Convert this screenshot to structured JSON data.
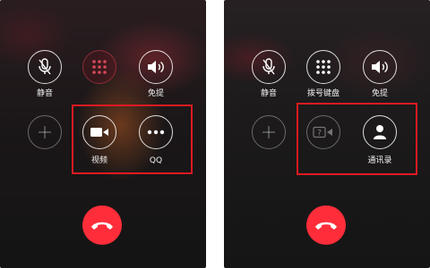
{
  "left_screen": {
    "mute_label": "静音",
    "speaker_label": "免提",
    "video_label": "视频",
    "qq_label": "QQ",
    "add_icon": "plus-icon",
    "keypad_icon": "keypad-icon"
  },
  "right_screen": {
    "mute_label": "静音",
    "keypad_label": "拨号键盘",
    "speaker_label": "免提",
    "contacts_label": "通讯录",
    "add_icon": "plus-icon",
    "facetime_icon": "facetime-disabled-icon"
  },
  "colors": {
    "highlight": "#e01a22",
    "end_call": "#ff2d3a"
  }
}
